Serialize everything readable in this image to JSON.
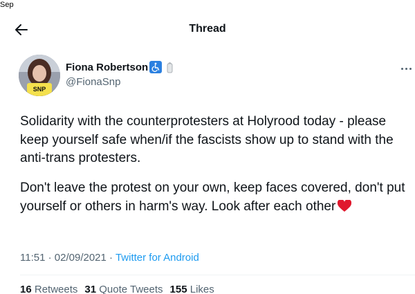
{
  "clipped_date": "Sep",
  "header": {
    "title": "Thread"
  },
  "tweet": {
    "author_name": "Fiona Robertson",
    "author_handle": "@FionaSnp",
    "avatar_badge_text": "SNP",
    "paragraphs": [
      "Solidarity with the counterprotesters at Holyrood today - please keep yourself safe when/if the fascists show up to stand with the anti-trans protesters.",
      "Don't leave the protest on your own, keep faces covered, don't put yourself or others in harm's way. Look after each other"
    ],
    "time": "11:51",
    "date": "02/09/2021",
    "separator": "·",
    "source": "Twitter for Android",
    "stats": {
      "retweets_count": "16",
      "retweets_label": "Retweets",
      "quotes_count": "31",
      "quotes_label": "Quote Tweets",
      "likes_count": "155",
      "likes_label": "Likes"
    }
  },
  "colors": {
    "accent": "#1d9bf0",
    "secondary_text": "#536471",
    "primary_text": "#0f1419",
    "accessibility_badge": "#2b80e0",
    "heart": "#e0182d"
  },
  "icons": {
    "back": "arrow-left-icon",
    "accessibility": "wheelchair-icon",
    "salt": "salt-shaker-icon",
    "more": "more-dots-icon",
    "heart": "red-heart-icon"
  }
}
